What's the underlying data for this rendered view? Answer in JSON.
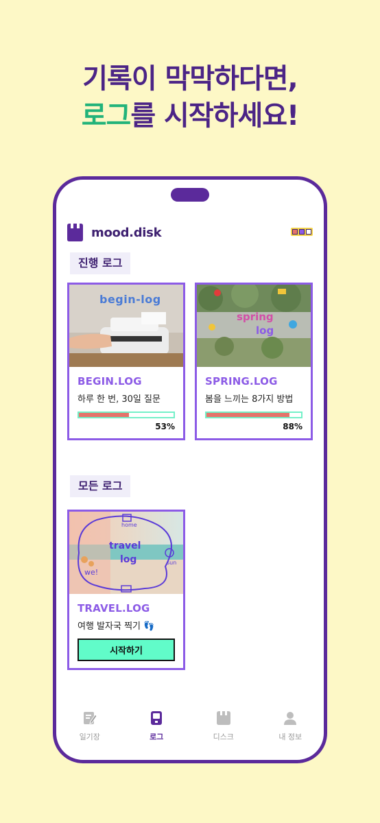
{
  "headline": {
    "line1": "기록이 막막하다면,",
    "line2_accent": "로그",
    "line2_rest": "를 시작하세요!"
  },
  "app": {
    "title": "mood.disk",
    "logo_icon": "disk-icon"
  },
  "sections": {
    "ongoing_label": "진행 로그",
    "all_label": "모든 로그"
  },
  "ongoing_logs": [
    {
      "title": "BEGIN.LOG",
      "desc": "하루 한 번, 30일 질문",
      "progress": 53,
      "progress_text": "53%",
      "thumb_text": "begin-log"
    },
    {
      "title": "SPRING.LOG",
      "desc": "봄을 느끼는 8가지 방법",
      "progress": 88,
      "progress_text": "88%",
      "thumb_text_1": "spring",
      "thumb_text_2": "log"
    }
  ],
  "all_logs": [
    {
      "title": "TRAVEL.LOG",
      "desc": "여행 발자국 찍기 👣",
      "button": "시작하기",
      "doodle": {
        "home": "home",
        "travel": "travel",
        "log": "log",
        "we": "we!",
        "sun": "sun"
      }
    }
  ],
  "tabs": [
    {
      "label": "일기장",
      "icon": "diary-edit-icon",
      "active": false
    },
    {
      "label": "로그",
      "icon": "log-device-icon",
      "active": true
    },
    {
      "label": "디스크",
      "icon": "disk-icon",
      "active": false
    },
    {
      "label": "내 정보",
      "icon": "profile-icon",
      "active": false
    }
  ],
  "colors": {
    "background": "#FDF8C6",
    "brand_purple": "#5B2A9B",
    "accent_green": "#22B37A",
    "card_border": "#8C5BE6",
    "progress_fill": "#E5736B",
    "progress_track": "#73F0C8",
    "button_bg": "#61FCC9"
  }
}
